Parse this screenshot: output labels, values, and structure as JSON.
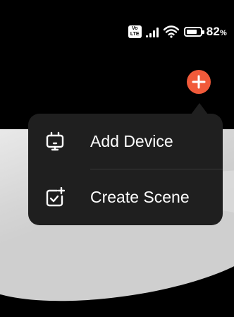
{
  "status_bar": {
    "volte_badge": [
      "Vo",
      "LTE"
    ],
    "battery_value": "82",
    "battery_unit": "%",
    "battery_level": 0.82
  },
  "add_button": {
    "icon": "plus-icon",
    "color": "#f15a3a"
  },
  "menu": {
    "items": [
      {
        "label": "Add Device",
        "icon": "device-icon"
      },
      {
        "label": "Create Scene",
        "icon": "scene-sparkle-icon"
      }
    ]
  },
  "colors": {
    "accent": "#f15a3a",
    "popup_bg": "#1f1f1f"
  }
}
